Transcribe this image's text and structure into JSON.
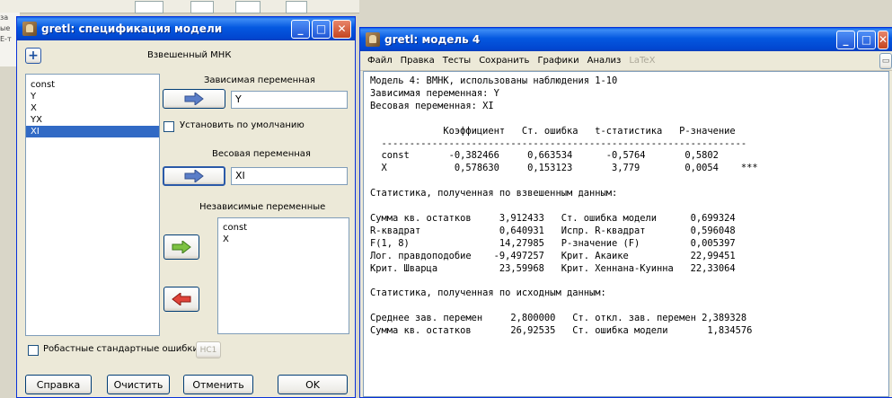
{
  "background": {
    "side_texts": [
      "за",
      "ые",
      "Е-т"
    ]
  },
  "spec_window": {
    "title": "gretl: спецификация модели",
    "method": "Взвешенный МНК",
    "variables": [
      "const",
      "Y",
      "X",
      "YX",
      "XI"
    ],
    "selected_variable": "XI",
    "dependent_label": "Зависимая переменная",
    "dependent_value": "Y",
    "default_checkbox_label": "Установить по умолчанию",
    "weight_label": "Весовая переменная",
    "weight_value": "XI",
    "independent_label": "Независимые переменные",
    "independent_vars": [
      "const",
      "X"
    ],
    "robust_label": "Робастные стандартные ошибки",
    "hc_button": "HC1",
    "buttons": {
      "help": "Справка",
      "clear": "Очистить",
      "cancel": "Отменить",
      "ok": "OK"
    }
  },
  "model_window": {
    "title": "gretl: модель 4",
    "menu": [
      "Файл",
      "Правка",
      "Тесты",
      "Сохранить",
      "Графики",
      "Анализ",
      "LaTeX"
    ],
    "output_lines": [
      "Модель 4: ВМНК, использованы наблюдения 1-10",
      "Зависимая переменная: Y",
      "Весовая переменная: XI",
      "",
      "             Коэффициент   Ст. ошибка   t-статистика   P-значение",
      "  -----------------------------------------------------------------",
      "  const       -0,382466     0,663534      -0,5764       0,5802",
      "  X            0,578630     0,153123       3,779        0,0054    ***",
      "",
      "Статистика, полученная по взвешенным данным:",
      "",
      "Сумма кв. остатков     3,912433   Ст. ошибка модели      0,699324",
      "R-квадрат              0,640931   Испр. R-квадрат        0,596048",
      "F(1, 8)                14,27985   Р-значение (F)         0,005397",
      "Лог. правдоподобие    -9,497257   Крит. Акаике           22,99451",
      "Крит. Шварца           23,59968   Крит. Хеннана-Куинна   22,33064",
      "",
      "Статистика, полученная по исходным данным:",
      "",
      "Среднее зав. перемен     2,800000   Ст. откл. зав. перемен 2,389328",
      "Сумма кв. остатков       26,92535   Ст. ошибка модели       1,834576"
    ]
  }
}
